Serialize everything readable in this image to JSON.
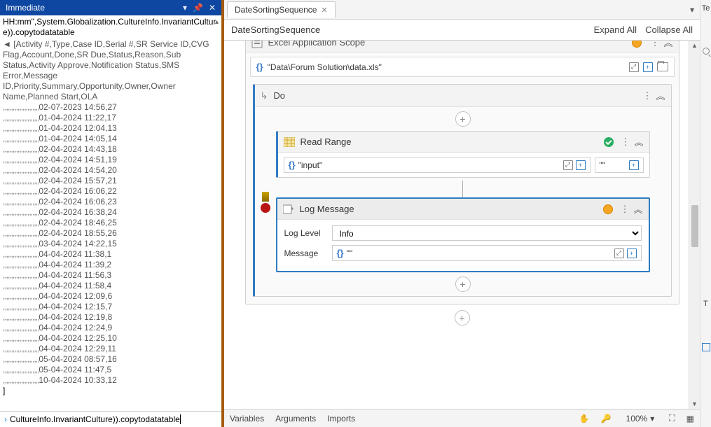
{
  "immediate": {
    "title": "Immediate",
    "topline": "HH:mm\",System.Globalization.CultureInfo.InvariantCulture)).copytodatatable",
    "meta1": "◄ [Activity #,Type,Case ID,Serial #,SR Service ID,CVG Flag,Account,Done,SR Due,Status,Reason,Sub Status,Activity Approve,Notification Status,SMS Error,Message ID,Priority,Summary,Opportunity,Owner,Owner Name,Planned Start,OLA",
    "rows": [
      "02-07-2023 14:56,27",
      "01-04-2024 11:22,17",
      "01-04-2024 12:04,13",
      "01-04-2024 14:05,14",
      "02-04-2024 14:43,18",
      "02-04-2024 14:51,19",
      "02-04-2024 14:54,20",
      "02-04-2024 15:57,21",
      "02-04-2024 16:06,22",
      "02-04-2024 16:06,23",
      "02-04-2024 16:38,24",
      "02-04-2024 18:46,25",
      "02-04-2024 18:55,26",
      "03-04-2024 14:22,15",
      "04-04-2024 11:38,1",
      "04-04-2024 11:39,2",
      "04-04-2024 11:56,3",
      "04-04-2024 11:58,4",
      "04-04-2024 12:09,6",
      "04-04-2024 12:15,7",
      "04-04-2024 12:19,8",
      "04-04-2024 12:24,9",
      "04-04-2024 12:25,10",
      "04-04-2024 12:29,11",
      "05-04-2024 08:57,16",
      "05-04-2024 11:47,5",
      "10-04-2024 10:33,12"
    ],
    "end_bracket": "]",
    "promptText": "CultureInfo.InvariantCulture)).copytodatatable"
  },
  "tabs": {
    "active": "DateSortingSequence",
    "breadcrumb": "DateSortingSequence",
    "expand_all": "Expand All",
    "collapse_all": "Collapse All"
  },
  "scope": {
    "title": "Excel Application Scope",
    "path": "\"Data\\Forum Solution\\data.xls\""
  },
  "do": {
    "title": "Do"
  },
  "readrange": {
    "title": "Read Range",
    "sheet": "\"input\"",
    "range": "\"\""
  },
  "log": {
    "title": "Log Message",
    "level_label": "Log Level",
    "level_value": "Info",
    "message_label": "Message",
    "message_value": "\"\""
  },
  "bottom": {
    "variables": "Variables",
    "arguments": "Arguments",
    "imports": "Imports",
    "zoom": "100%"
  },
  "rightstrip": {
    "te": "Te",
    "t": "T"
  }
}
